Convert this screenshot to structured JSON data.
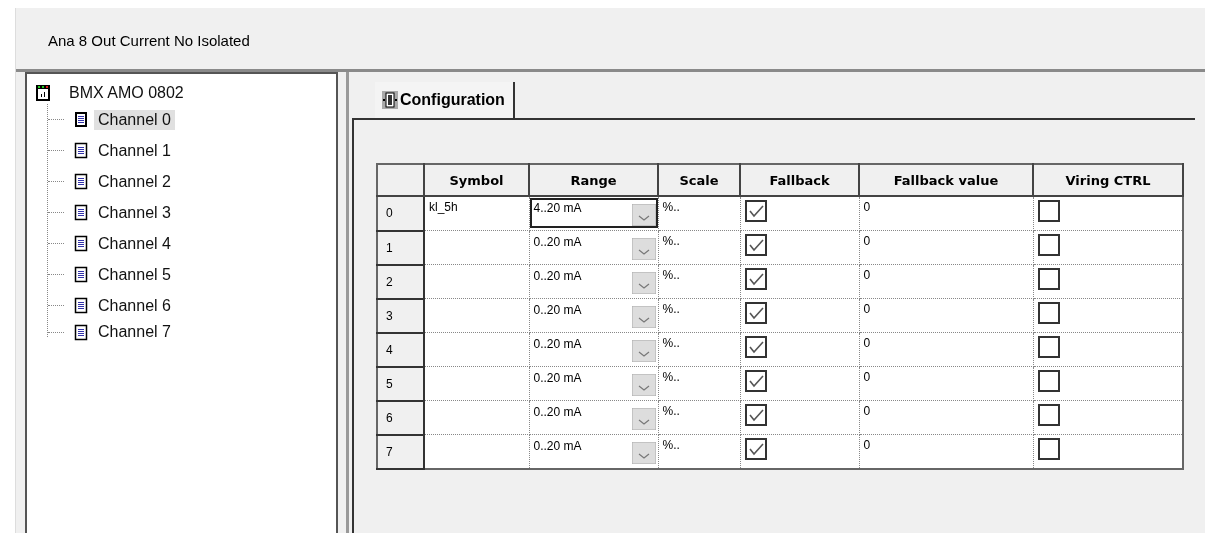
{
  "header": {
    "title": "Ana 8 Out Current No Isolated"
  },
  "tree": {
    "label": "BMX AMO 0802",
    "children": [
      {
        "label": "Channel 0",
        "selected": true
      },
      {
        "label": "Channel 1",
        "selected": false
      },
      {
        "label": "Channel 2",
        "selected": false
      },
      {
        "label": "Channel 3",
        "selected": false
      },
      {
        "label": "Channel 4",
        "selected": false
      },
      {
        "label": "Channel 5",
        "selected": false
      },
      {
        "label": "Channel 6",
        "selected": false
      },
      {
        "label": "Channel 7",
        "selected": false
      }
    ]
  },
  "tabs": [
    {
      "label": "Configuration",
      "selected": true
    }
  ],
  "table": {
    "columns": [
      "Symbol",
      "Range",
      "Scale",
      "Fallback",
      "Fallback value",
      "Viring CTRL"
    ],
    "rows": [
      {
        "index": "0",
        "symbol": "kl_5h",
        "range": "4..20 mA",
        "scale": "%..",
        "fallback": true,
        "fallback_value": "0",
        "wiring_ctrl": false,
        "selected": true
      },
      {
        "index": "1",
        "range": "0..20 mA",
        "scale": "%..",
        "fallback": true,
        "fallback_value": "0",
        "wiring_ctrl": false,
        "selected": false
      },
      {
        "index": "2",
        "range": "0..20 mA",
        "scale": "%..",
        "fallback": true,
        "fallback_value": "0",
        "wiring_ctrl": false,
        "selected": false
      },
      {
        "index": "3",
        "range": "0..20 mA",
        "scale": "%..",
        "fallback": true,
        "fallback_value": "0",
        "wiring_ctrl": false,
        "selected": false
      },
      {
        "index": "4",
        "range": "0..20 mA",
        "scale": "%..",
        "fallback": true,
        "fallback_value": "0",
        "wiring_ctrl": false,
        "selected": false
      },
      {
        "index": "5",
        "range": "0..20 mA",
        "scale": "%..",
        "fallback": true,
        "fallback_value": "0",
        "wiring_ctrl": false,
        "selected": false
      },
      {
        "index": "6",
        "range": "0..20 mA",
        "scale": "%..",
        "fallback": true,
        "fallback_value": "0",
        "wiring_ctrl": false,
        "selected": false
      },
      {
        "index": "7",
        "range": "0..20 mA",
        "scale": "%..",
        "fallback": true,
        "fallback_value": "0",
        "wiring_ctrl": false,
        "selected": false
      }
    ]
  }
}
